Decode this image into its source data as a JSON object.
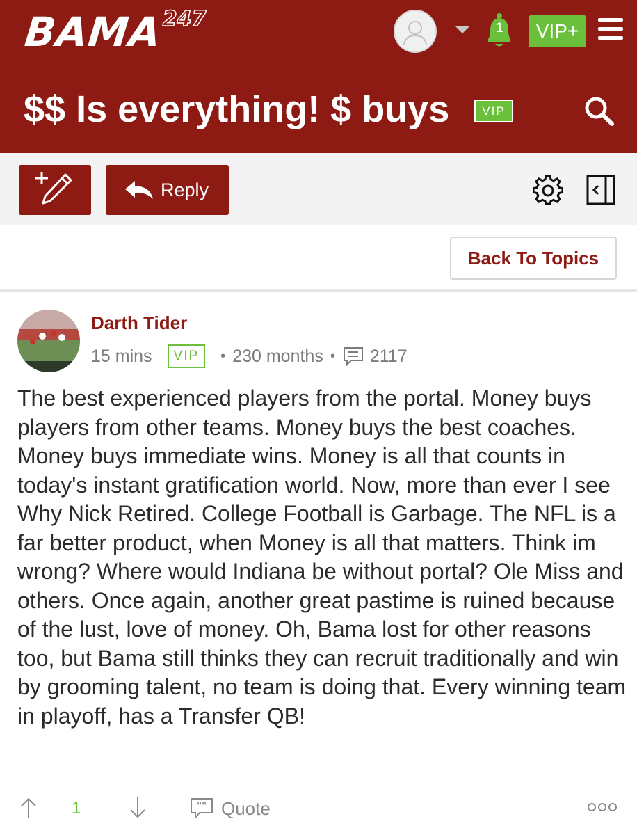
{
  "header": {
    "logo_main": "BAMA",
    "logo_sup": "247",
    "notifications_count": "1",
    "vip_plus_label": "VIP+",
    "thread_title": "$$ Is everything! $ buys",
    "vip_badge": "VIP",
    "background_color": "#8e1a14"
  },
  "toolbar": {
    "new_post_icon": "pencil-plus-icon",
    "reply_label": "Reply",
    "settings_icon": "gear-icon",
    "collapse_icon": "collapse-panel-icon"
  },
  "navigation": {
    "back_label": "Back To Topics"
  },
  "post": {
    "author": "Darth Tider",
    "time_ago": "15 mins",
    "vip_badge": "VIP",
    "membership": "230 months",
    "post_count": "2117",
    "body": "The best experienced players from the portal. Money buys players from other teams. Money buys the best coaches. Money buys immediate wins. Money is all that counts in today's instant gratification world. Now, more than ever I see Why Nick Retired. College Football is Garbage. The NFL is a far better product, when Money is all that matters. Think im wrong? Where would Indiana be without portal? Ole Miss and others. Once again, another great pastime is ruined because of the lust, love of money. Oh, Bama lost for other reasons too, but Bama still thinks they can recruit traditionally and win by grooming talent, no team is doing that. Every winning team in playoff, has a Transfer QB!",
    "upvotes": "1",
    "quote_label": "Quote"
  },
  "colors": {
    "brand_red": "#8e1a14",
    "vip_green": "#6abf3b"
  }
}
